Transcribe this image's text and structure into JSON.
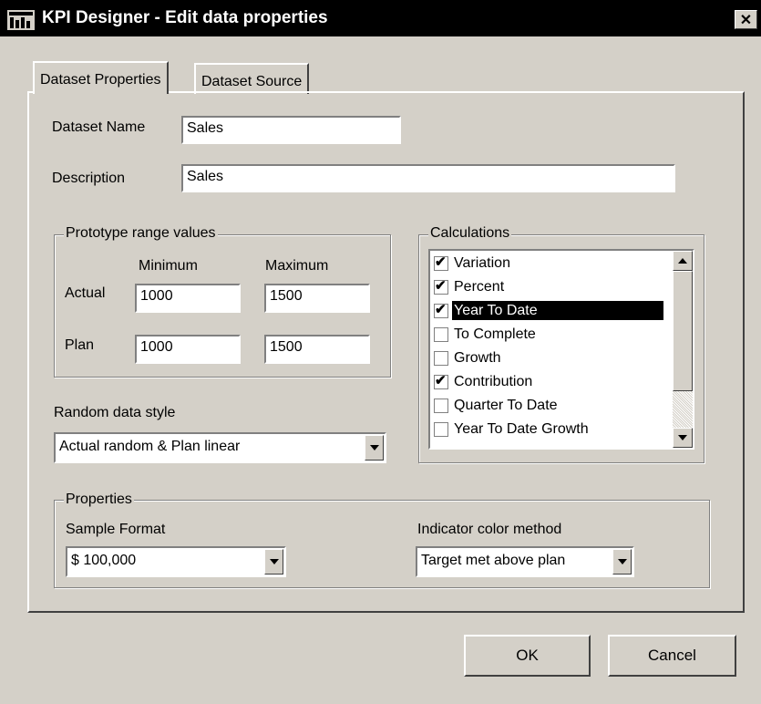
{
  "window": {
    "title": "KPI Designer - Edit data properties",
    "close_glyph": "✕",
    "icon": "kpi-app-icon"
  },
  "tabs": [
    {
      "label": "Dataset Properties",
      "active": true
    },
    {
      "label": "Dataset Source",
      "active": false
    }
  ],
  "dataset": {
    "name_label": "Dataset Name",
    "name_value": "Sales",
    "description_label": "Description",
    "description_value": "Sales"
  },
  "prototype": {
    "title": "Prototype range values",
    "min_header": "Minimum",
    "max_header": "Maximum",
    "actual_label": "Actual",
    "actual_min": "1000",
    "actual_max": "1500",
    "plan_label": "Plan",
    "plan_min": "1000",
    "plan_max": "1500"
  },
  "random": {
    "label": "Random data style",
    "selected": "Actual random & Plan linear"
  },
  "calculations": {
    "title": "Calculations",
    "items": [
      {
        "label": "Variation",
        "checked": true,
        "selected": false
      },
      {
        "label": "Percent",
        "checked": true,
        "selected": false
      },
      {
        "label": "Year To Date",
        "checked": true,
        "selected": true
      },
      {
        "label": "To Complete",
        "checked": false,
        "selected": false
      },
      {
        "label": "Growth",
        "checked": false,
        "selected": false
      },
      {
        "label": "Contribution",
        "checked": true,
        "selected": false
      },
      {
        "label": "Quarter To Date",
        "checked": false,
        "selected": false
      },
      {
        "label": "Year To Date Growth",
        "checked": false,
        "selected": false
      }
    ]
  },
  "properties": {
    "title": "Properties",
    "sample_format_label": "Sample Format",
    "sample_format_value": "$ 100,000",
    "indicator_label": "Indicator color method",
    "indicator_value": "Target met above plan"
  },
  "buttons": {
    "ok": "OK",
    "cancel": "Cancel"
  },
  "colors": {
    "face": "#d4d0c8",
    "titlebar": "#000000",
    "selection": "#000000"
  }
}
